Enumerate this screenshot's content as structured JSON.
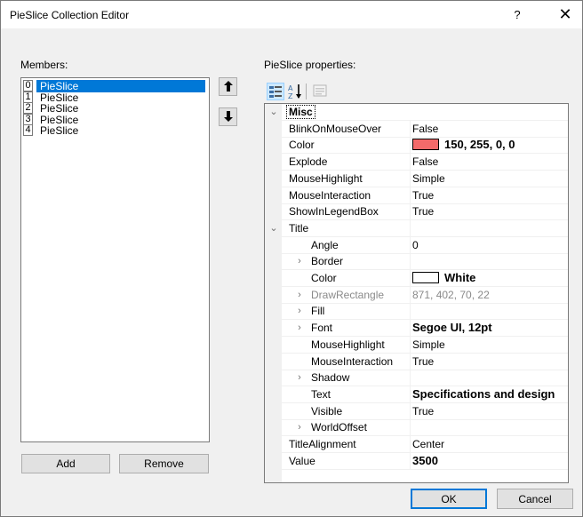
{
  "window": {
    "title": "PieSlice Collection Editor",
    "help_label": "?",
    "close_label": "✕"
  },
  "members": {
    "label": "Members:",
    "items": [
      {
        "index": "0",
        "name": "PieSlice",
        "selected": true
      },
      {
        "index": "1",
        "name": "PieSlice",
        "selected": false
      },
      {
        "index": "2",
        "name": "PieSlice",
        "selected": false
      },
      {
        "index": "3",
        "name": "PieSlice",
        "selected": false
      },
      {
        "index": "4",
        "name": "PieSlice",
        "selected": false
      }
    ],
    "move_up_label": "🡅",
    "move_down_label": "🡇",
    "add_label": "Add",
    "remove_label": "Remove"
  },
  "properties": {
    "label": "PieSlice properties:",
    "rows": [
      {
        "kind": "category",
        "name": "Misc",
        "value": "",
        "expander": "⌄"
      },
      {
        "kind": "prop",
        "name": "BlinkOnMouseOver",
        "value": "False"
      },
      {
        "kind": "prop",
        "name": "Color",
        "value": "150, 255, 0, 0",
        "swatch": "#f46a6a",
        "bold": true
      },
      {
        "kind": "prop",
        "name": "Explode",
        "value": "False"
      },
      {
        "kind": "prop",
        "name": "MouseHighlight",
        "value": "Simple"
      },
      {
        "kind": "prop",
        "name": "MouseInteraction",
        "value": "True"
      },
      {
        "kind": "prop",
        "name": "ShowInLegendBox",
        "value": "True"
      },
      {
        "kind": "group",
        "name": "Title",
        "value": "",
        "expander": "⌄"
      },
      {
        "kind": "sub",
        "name": "Angle",
        "value": "0"
      },
      {
        "kind": "sub",
        "name": "Border",
        "value": "",
        "expander": "›"
      },
      {
        "kind": "sub",
        "name": "Color",
        "value": "White",
        "swatch": "#ffffff",
        "bold": true
      },
      {
        "kind": "sub",
        "name": "DrawRectangle",
        "value": "871, 402, 70, 22",
        "expander": "›",
        "grey": true
      },
      {
        "kind": "sub",
        "name": "Fill",
        "value": "",
        "expander": "›"
      },
      {
        "kind": "sub",
        "name": "Font",
        "value": "Segoe UI, 12pt",
        "expander": "›",
        "bold": true
      },
      {
        "kind": "sub",
        "name": "MouseHighlight",
        "value": "Simple"
      },
      {
        "kind": "sub",
        "name": "MouseInteraction",
        "value": "True"
      },
      {
        "kind": "sub",
        "name": "Shadow",
        "value": "",
        "expander": "›"
      },
      {
        "kind": "sub",
        "name": "Text",
        "value": "Specifications and design",
        "bold": true
      },
      {
        "kind": "sub",
        "name": "Visible",
        "value": "True"
      },
      {
        "kind": "sub",
        "name": "WorldOffset",
        "value": "",
        "expander": "›"
      },
      {
        "kind": "prop",
        "name": "TitleAlignment",
        "value": "Center"
      },
      {
        "kind": "prop",
        "name": "Value",
        "value": "3500",
        "bold": true
      }
    ]
  },
  "footer": {
    "ok_label": "OK",
    "cancel_label": "Cancel"
  },
  "colors": {
    "selection": "#0078d7",
    "dialog_bg": "#f0f0f0"
  }
}
